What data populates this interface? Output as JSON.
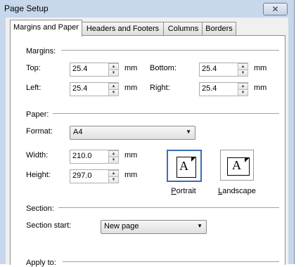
{
  "window": {
    "title": "Page Setup",
    "close_glyph": "✕"
  },
  "tabs": [
    {
      "label": "Margins and Paper",
      "active": true
    },
    {
      "label": "Headers and Footers",
      "active": false
    },
    {
      "label": "Columns",
      "active": false
    },
    {
      "label": "Borders",
      "active": false
    }
  ],
  "margins": {
    "group_label": "Margins:",
    "top": {
      "label": "Top:",
      "value": "25.4",
      "unit": "mm"
    },
    "bottom": {
      "label": "Bottom:",
      "value": "25.4",
      "unit": "mm"
    },
    "left": {
      "label": "Left:",
      "value": "25.4",
      "unit": "mm"
    },
    "right": {
      "label": "Right:",
      "value": "25.4",
      "unit": "mm"
    }
  },
  "paper": {
    "group_label": "Paper:",
    "format": {
      "label": "Format:",
      "value": "A4"
    },
    "width": {
      "label": "Width:",
      "value": "210.0",
      "unit": "mm"
    },
    "height": {
      "label": "Height:",
      "value": "297.0",
      "unit": "mm"
    },
    "orientation": {
      "portrait": {
        "label": "Portrait",
        "accel": "P",
        "rest": "ortrait",
        "glyph": "A",
        "selected": true
      },
      "landscape": {
        "label": "Landscape",
        "accel": "L",
        "rest": "andscape",
        "glyph": "A",
        "selected": false
      }
    }
  },
  "section": {
    "group_label": "Section:",
    "start": {
      "label": "Section start:",
      "value": "New page"
    }
  },
  "apply": {
    "label": "Apply to:"
  },
  "icons": {
    "spin_up": "▲",
    "spin_down": "▼",
    "dropdown": "▼"
  }
}
